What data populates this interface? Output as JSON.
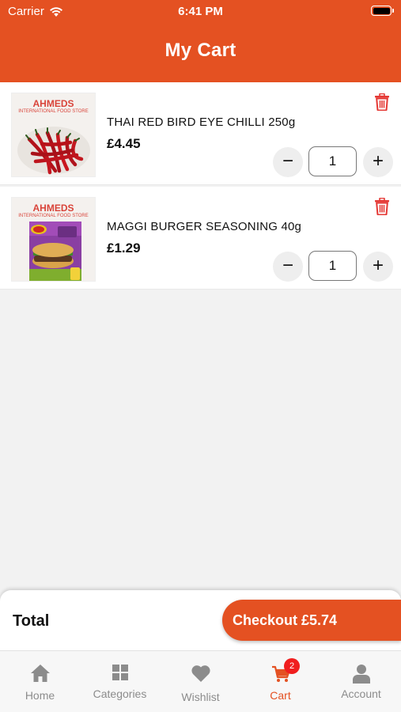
{
  "status_bar": {
    "carrier": "Carrier",
    "time": "6:41 PM"
  },
  "header": {
    "title": "My Cart"
  },
  "colors": {
    "accent": "#e45122",
    "delete": "#e53935",
    "badge": "#f01e1e"
  },
  "cart": {
    "items": [
      {
        "brand": "AHMEDS",
        "store": "INTERNATIONAL FOOD STORE",
        "name": "THAI RED BIRD EYE CHILLI 250g",
        "price": "£4.45",
        "quantity": "1"
      },
      {
        "brand": "AHMEDS",
        "store": "INTERNATIONAL FOOD STORE",
        "name": "MAGGI BURGER SEASONING 40g",
        "price": "£1.29",
        "quantity": "1"
      }
    ],
    "minus_symbol": "−",
    "plus_symbol": "+"
  },
  "footer": {
    "total_label": "Total",
    "checkout_label": "Checkout £5.74"
  },
  "nav": {
    "items": [
      {
        "label": "Home",
        "icon": "home-icon"
      },
      {
        "label": "Categories",
        "icon": "grid-icon"
      },
      {
        "label": "Wishlist",
        "icon": "heart-icon"
      },
      {
        "label": "Cart",
        "icon": "cart-icon",
        "badge": "2",
        "active": true
      },
      {
        "label": "Account",
        "icon": "person-icon"
      }
    ]
  }
}
